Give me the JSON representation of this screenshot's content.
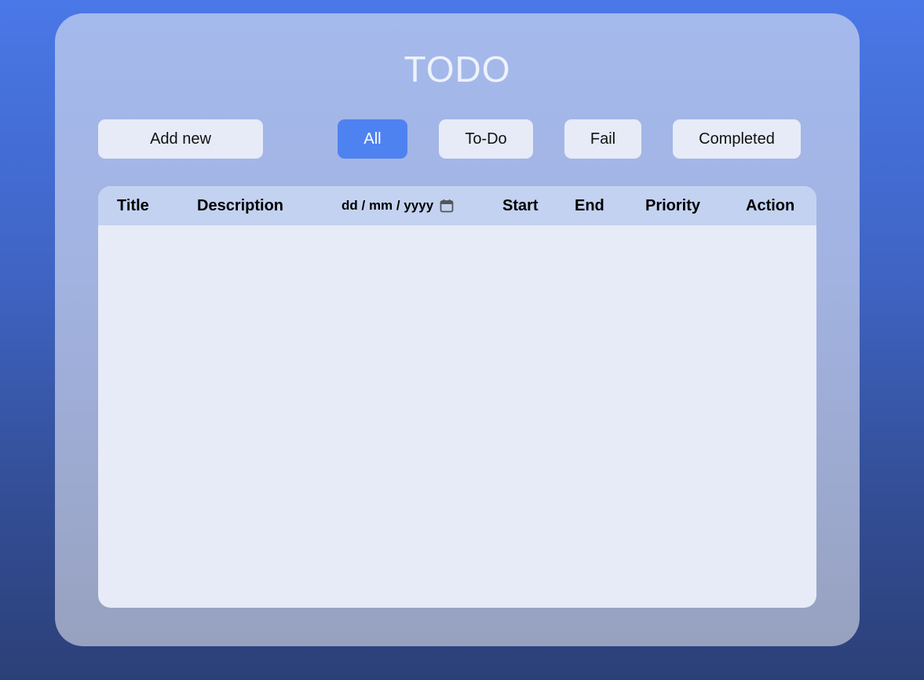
{
  "app": {
    "title": "TODO"
  },
  "toolbar": {
    "add_label": "Add new",
    "filters": [
      {
        "label": "All",
        "active": true
      },
      {
        "label": "To-Do",
        "active": false
      },
      {
        "label": "Fail",
        "active": false
      },
      {
        "label": "Completed",
        "active": false
      }
    ]
  },
  "table": {
    "columns": {
      "title": "Title",
      "description": "Description",
      "date_placeholder": "dd / mm / yyyy",
      "start": "Start",
      "end": "End",
      "priority": "Priority",
      "action": "Action"
    },
    "rows": []
  },
  "colors": {
    "accent": "#4f82f1",
    "button_bg": "#e6ebf7",
    "header_bg": "#c3d2f0"
  },
  "icons": {
    "date_picker": "calendar-icon"
  }
}
